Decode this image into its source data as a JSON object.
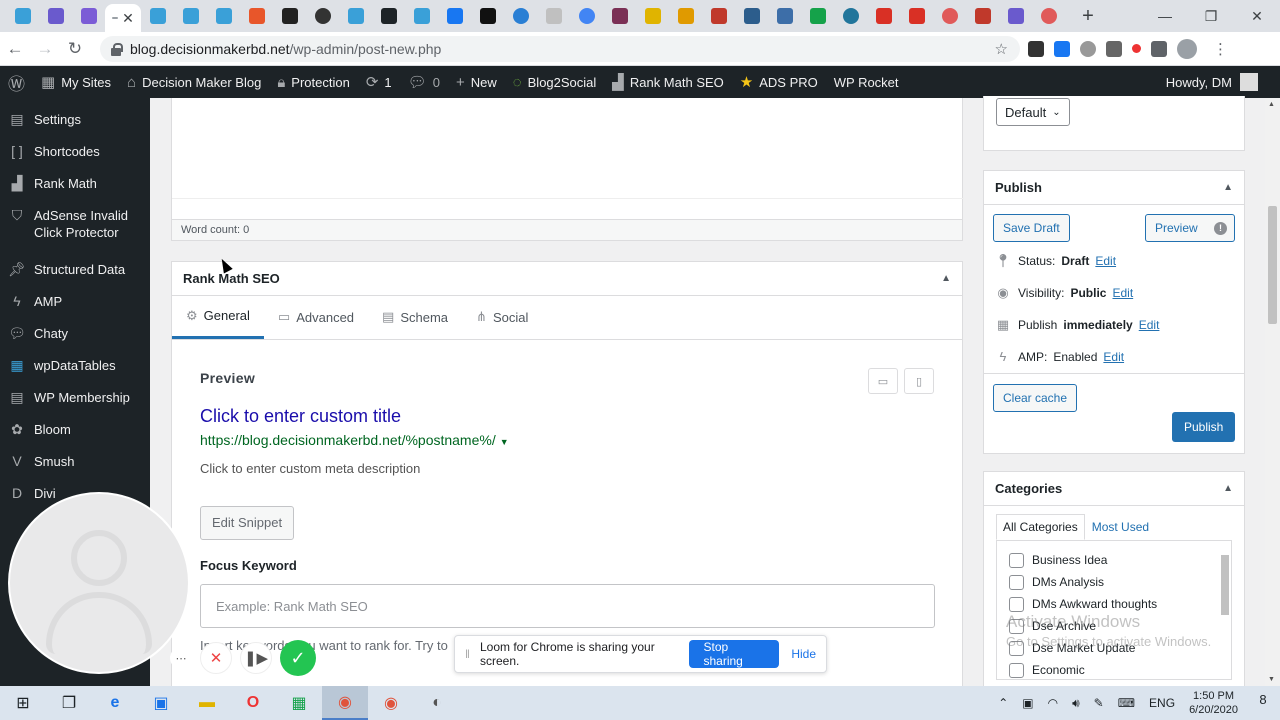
{
  "browser": {
    "tab_count": 31,
    "new_tab_label": "+",
    "url_host": "blog.decisionmakerbd.net",
    "url_path": "/wp-admin/post-new.php"
  },
  "adminbar": {
    "my_sites": "My Sites",
    "site_name": "Decision Maker Blog",
    "protection": "Protection",
    "updates_count": "1",
    "comments_count": "0",
    "new_label": "New",
    "blog2social": "Blog2Social",
    "rank_math_seo": "Rank Math SEO",
    "ads_pro": "ADS PRO",
    "wp_rocket": "WP Rocket",
    "howdy": "Howdy, DM"
  },
  "sidebar": {
    "items": [
      {
        "label": "Settings",
        "icon": "settings-icon"
      },
      {
        "label": "Shortcodes",
        "icon": "brackets-icon"
      },
      {
        "label": "Rank Math",
        "icon": "chart-icon"
      },
      {
        "label": "AdSense Invalid Click Protector",
        "icon": "shield-icon"
      },
      {
        "label": "Structured Data",
        "icon": "pin-icon"
      },
      {
        "label": "AMP",
        "icon": "amp-icon"
      },
      {
        "label": "Chaty",
        "icon": "chat-icon"
      },
      {
        "label": "wpDataTables",
        "icon": "table-icon"
      },
      {
        "label": "WP Membership",
        "icon": "membership-icon"
      },
      {
        "label": "Bloom",
        "icon": "bloom-icon"
      },
      {
        "label": "Smush",
        "icon": "smush-icon"
      },
      {
        "label": "Divi",
        "icon": "divi-icon"
      }
    ]
  },
  "editor": {
    "word_count": "Word count: 0"
  },
  "rank_math": {
    "title": "Rank Math SEO",
    "tabs": [
      "General",
      "Advanced",
      "Schema",
      "Social"
    ],
    "active_tab": "General",
    "preview_label": "Preview",
    "serp_title": "Click to enter custom title",
    "serp_url": "https://blog.decisionmakerbd.net/%postname%/",
    "serp_desc": "Click to enter custom meta description",
    "edit_snippet": "Edit Snippet",
    "focus_keyword_label": "Focus Keyword",
    "focus_keyword_placeholder": "Example: Rank Math SEO",
    "focus_help": "Insert keywords you want to rank for. Try to"
  },
  "publish_box": {
    "template_value": "Default",
    "title": "Publish",
    "save_draft": "Save Draft",
    "preview": "Preview",
    "status_label": "Status:",
    "status_value": "Draft",
    "visibility_label": "Visibility:",
    "visibility_value": "Public",
    "publish_label": "Publish",
    "publish_value": "immediately",
    "amp_label": "AMP:",
    "amp_value": "Enabled",
    "edit": "Edit",
    "clear_cache": "Clear cache",
    "publish_button": "Publish"
  },
  "categories": {
    "title": "Categories",
    "tab_all": "All Categories",
    "tab_most_used": "Most Used",
    "items": [
      "Business Idea",
      "DMs Analysis",
      "DMs Awkward thoughts",
      "Dse Archive",
      "Dse Market Update",
      "Economic"
    ]
  },
  "watermark": {
    "title": "Activate Windows",
    "subtitle": "Go to Settings to activate Windows."
  },
  "loom": {
    "message": "Loom for Chrome is sharing your screen.",
    "stop": "Stop sharing",
    "hide": "Hide"
  },
  "taskbar": {
    "lang": "ENG",
    "time": "1:50 PM",
    "date": "6/20/2020",
    "notifications": "8"
  }
}
